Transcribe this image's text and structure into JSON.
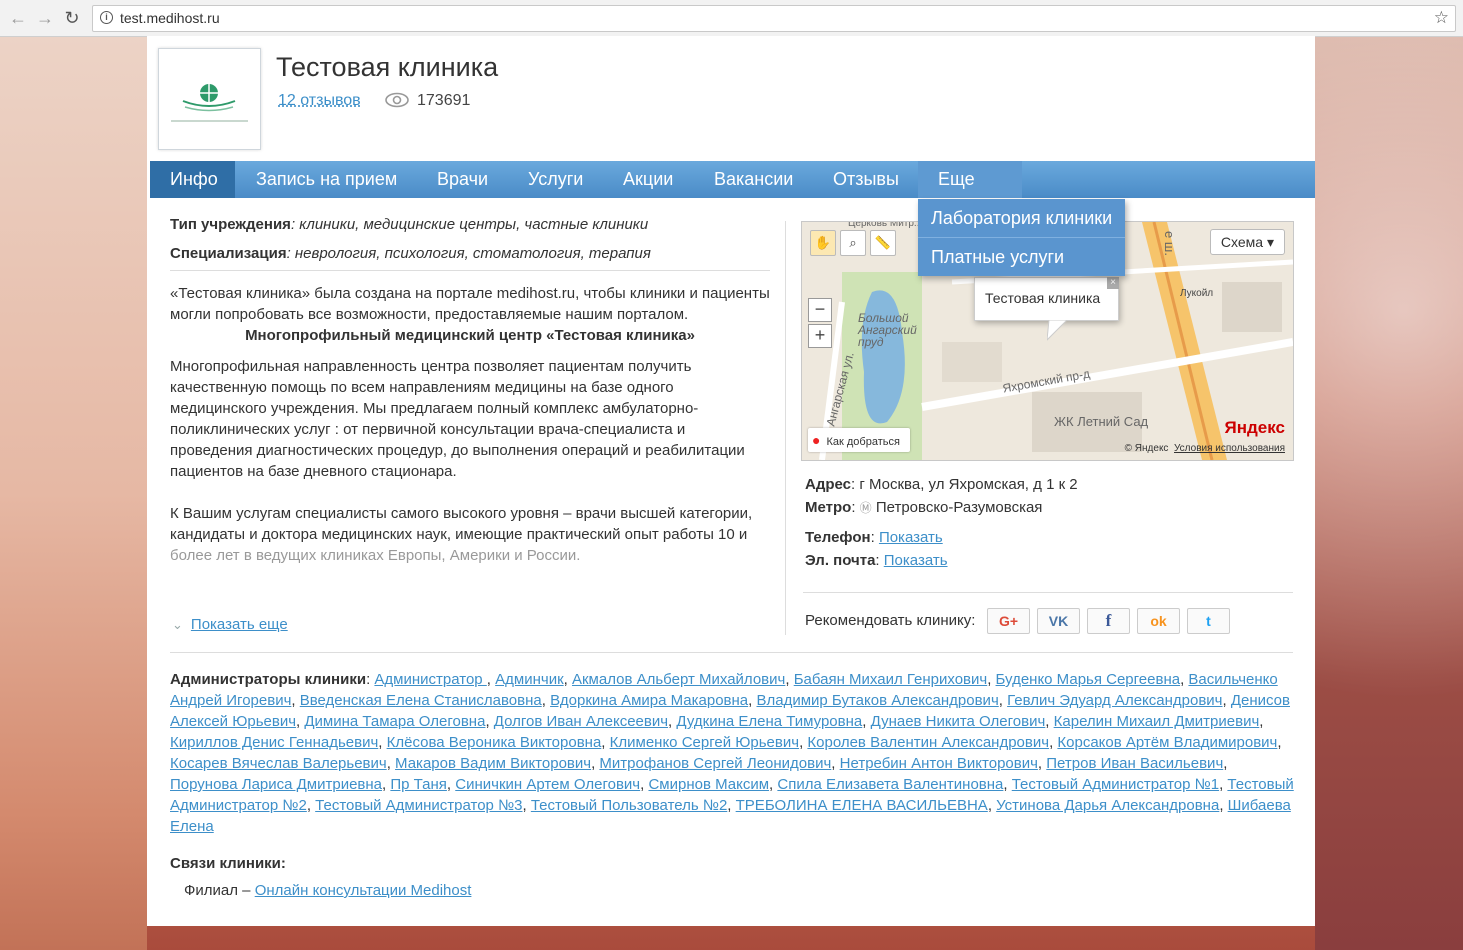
{
  "browser": {
    "url": "test.medihost.ru"
  },
  "clinic": {
    "name": "Тестовая клиника",
    "reviews": "12 отзывов",
    "views": "173691"
  },
  "nav": {
    "items": [
      "Инфо",
      "Запись на прием",
      "Врачи",
      "Услуги",
      "Акции",
      "Вакансии",
      "Отзывы",
      "Еще"
    ],
    "dropdown": [
      "Лаборатория клиники",
      "Платные услуги"
    ]
  },
  "info": {
    "type_label": "Тип учреждения",
    "type_value": ": клиники, медицинские центры, частные клиники",
    "spec_label": "Специализация",
    "spec_value": ": неврология, психология, стоматология, терапия",
    "intro": "«Тестовая клиника» была создана на портале medihost.ru, чтобы клиники и пациенты могли попробовать все возможности, предоставляемые нашим порталом.",
    "heading": "Многопрофильный медицинский центр «Тестовая клиника»",
    "para1": "Многопрофильная направленность центра позволяет пациентам получить качественную помощь по всем направлениям  медицины  на базе одного медицинского учреждения.  Мы предлагаем полный  комплекс амбулаторно-поликлинических услуг : от первичной консультации врача-специалиста и проведения диагностических процедур,  до выполнения операций и реабилитации пациентов на базе дневного стационара.",
    "para2a": "К Вашим услугам специалисты самого высокого уровня – врачи высшей категории, кандидаты и доктора медицинских наук, имеющие практический опыт работы 10 и",
    "para2b": "более лет в ведущих клиниках Европы, Америки и России.",
    "show_more": "Показать еще"
  },
  "map": {
    "scheme": "Схема",
    "balloon": "Тестовая клиника",
    "route": "Как добраться",
    "logo": "Яндекс",
    "copyright": "© Яндекс",
    "terms": "Условия использования",
    "pond": "Большой Ангарский пруд",
    "street1": "Яхромский пр-д",
    "street2": "Ангарская ул.",
    "complex": "ЖК Летний Сад",
    "fuel": "Лукойл",
    "top_partial": "Церковь Митр...",
    "road_partial": "е ш."
  },
  "contacts": {
    "address_label": "Адрес",
    "address": ": г Москва, ул Яхромская, д 1 к 2",
    "metro_label": "Метро",
    "metro": "Петровско-Разумовская",
    "phone_label": "Телефон",
    "email_label": "Эл. почта",
    "show": "Показать",
    "recommend": "Рекомендовать клинику:"
  },
  "share": {
    "google": "G+",
    "vk": "VK",
    "facebook": "f",
    "ok": "ok",
    "twitter": "t"
  },
  "admins": {
    "label": "Администраторы клиники",
    "names": [
      "Администратор ",
      "Админчик",
      "Акмалов Альберт Михайлович",
      "Бабаян Михаил Генрихович",
      "Буденко Марья Сергеевна",
      "Васильченко Андрей Игоревич",
      "Введенская Елена Станиславовна",
      "Вдоркина Амира Макаровна",
      "Владимир Бутаков Александрович",
      "Гевлич Эдуард Александрович",
      "Денисов Алексей Юрьевич",
      "Димина Тамара Олеговна",
      "Долгов Иван Алексеевич",
      "Дудкина Елена Тимуровна",
      "Дунаев Никита Олегович",
      "Карелин Михаил Дмитриевич",
      "Кириллов Денис Геннадьевич",
      "Клёсова Вероника Викторовна",
      "Клименко Сергей Юрьевич",
      "Королев Валентин Александрович",
      "Корсаков Артём Владимирович",
      "Косарев Вячеслав Валерьевич",
      "Макаров Вадим Викторович",
      "Митрофанов Сергей Леонидович",
      "Нетребин Антон Викторович",
      "Петров Иван Васильевич",
      "Порунова Лариса Дмитриевна",
      "Пр Таня",
      "Синичкин Артем Олегович",
      "Смирнов Максим",
      "Спила Елизавета Валентиновна",
      "Тестовый Администратор №1",
      "Тестовый Администратор №2",
      "Тестовый Администратор №3",
      "Тестовый Пользователь №2",
      "ТРЕБОЛИНА ЕЛЕНА ВАСИЛЬЕВНА",
      "Устинова Дарья Александровна",
      "Шибаева Елена"
    ]
  },
  "relations": {
    "label": "Связи клиники:",
    "filial_label": "Филиал – ",
    "filial_link": "Онлайн консультации Medihost"
  }
}
